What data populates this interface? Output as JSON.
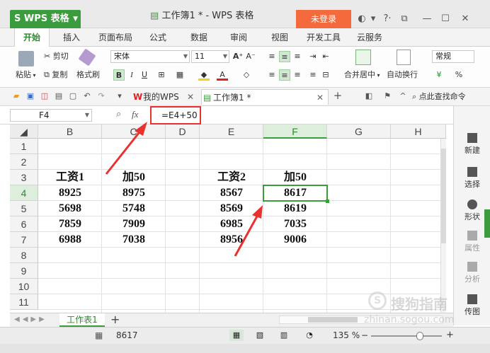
{
  "titlebar": {
    "app_name": "WPS 表格",
    "doc_title": "工作簿1 * - WPS 表格",
    "login_label": "未登录",
    "help_label": "?·"
  },
  "menu": {
    "tabs": [
      "开始",
      "插入",
      "页面布局",
      "公式",
      "数据",
      "审阅",
      "视图",
      "开发工具",
      "云服务"
    ],
    "active": "开始"
  },
  "ribbon": {
    "paste": "粘贴",
    "cut": "剪切",
    "copy": "复制",
    "format_painter": "格式刷",
    "font_name": "宋体",
    "font_size": "11",
    "bold": "B",
    "italic": "I",
    "underline": "U",
    "merge_center": "合并居中",
    "wrap_text": "自动换行",
    "number_format": "常规",
    "percent": "%"
  },
  "quickaccess": {
    "tabs": [
      {
        "label": "我的WPS"
      },
      {
        "label": "工作簿1 *"
      }
    ],
    "search_label": "点此查找命令"
  },
  "formula_bar": {
    "name_box": "F4",
    "fx_label": "fx",
    "formula": "=E4+50"
  },
  "grid": {
    "columns": [
      "B",
      "C",
      "D",
      "E",
      "F",
      "G",
      "H"
    ],
    "rows": [
      "1",
      "2",
      "3",
      "4",
      "5",
      "6",
      "7",
      "8",
      "9",
      "10",
      "11"
    ],
    "selected_column": "F",
    "selected_row": "4",
    "cells": {
      "B3": "工资1",
      "C3": "加50",
      "E3": "工资2",
      "F3": "加50",
      "B4": "8925",
      "C4": "8975",
      "E4": "8567",
      "F4": "8617",
      "B5": "5698",
      "C5": "5748",
      "E5": "8569",
      "F5": "8619",
      "B6": "7859",
      "C6": "7909",
      "E6": "6985",
      "F6": "7035",
      "B7": "6988",
      "C7": "7038",
      "E7": "8956",
      "F7": "9006"
    }
  },
  "right_panel": {
    "items": [
      "新建",
      "选择",
      "形状",
      "属性",
      "分析",
      "传图"
    ]
  },
  "sheets": {
    "tabs": [
      "工作表1"
    ],
    "add": "+"
  },
  "status": {
    "value": "8617",
    "zoom": "135 %"
  },
  "watermark": {
    "text": "搜狗指南",
    "url": "zhinan.sogou.com"
  },
  "colors": {
    "accent": "#3c9b3c",
    "login": "#f56a3d",
    "annotation": "#e8322f"
  }
}
